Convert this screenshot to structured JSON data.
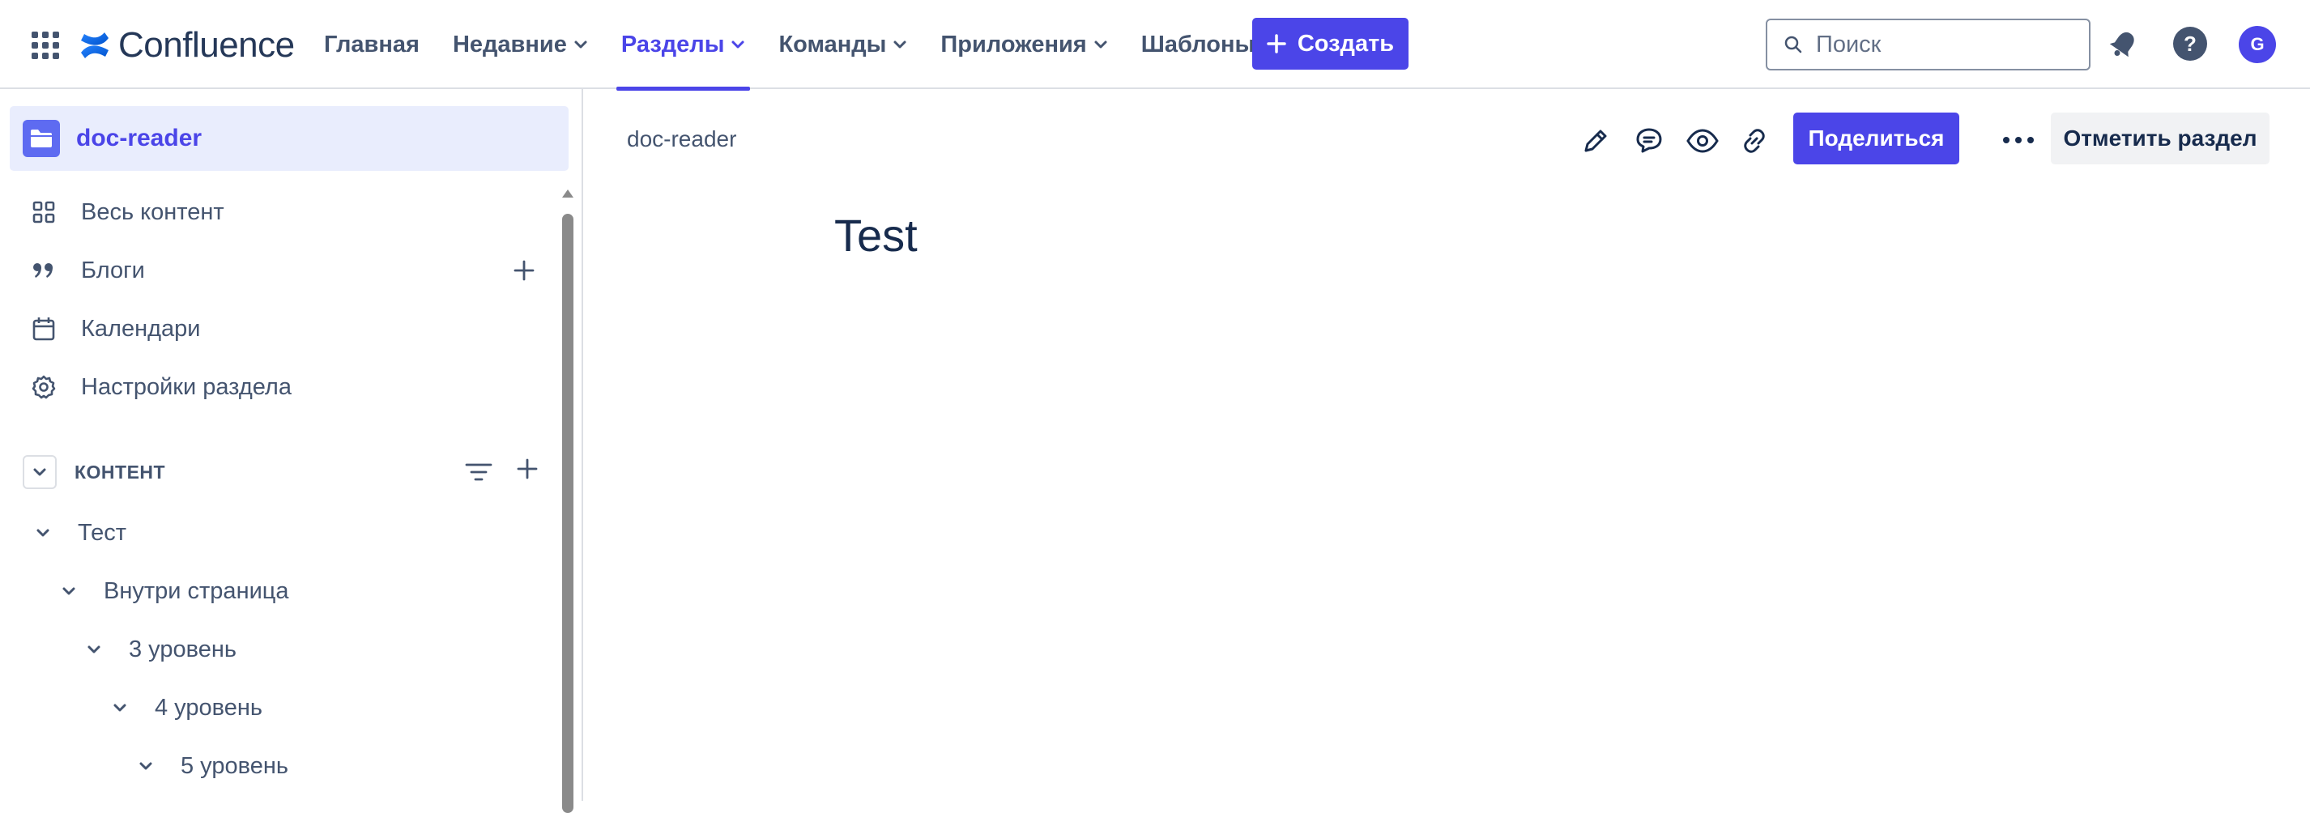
{
  "app": {
    "name": "Confluence"
  },
  "nav": {
    "links": [
      {
        "label": "Главная",
        "has_dropdown": false,
        "active": false
      },
      {
        "label": "Недавние",
        "has_dropdown": true,
        "active": false
      },
      {
        "label": "Разделы",
        "has_dropdown": true,
        "active": true
      },
      {
        "label": "Команды",
        "has_dropdown": true,
        "active": false
      },
      {
        "label": "Приложения",
        "has_dropdown": true,
        "active": false
      },
      {
        "label": "Шаблоны",
        "has_dropdown": false,
        "active": false
      }
    ],
    "create_label": "Создать",
    "search_placeholder": "Поиск",
    "avatar_initial": "G"
  },
  "sidebar": {
    "space_name": "doc-reader",
    "items": [
      {
        "label": "Весь контент",
        "icon": "grid-icon"
      },
      {
        "label": "Блоги",
        "icon": "quote-icon"
      },
      {
        "label": "Календари",
        "icon": "calendar-icon"
      },
      {
        "label": "Настройки раздела",
        "icon": "gear-icon"
      }
    ],
    "content_title": "КОНТЕНТ",
    "tree": [
      {
        "label": "Тест",
        "level": 0
      },
      {
        "label": "Внутри страница",
        "level": 1
      },
      {
        "label": "3 уровень",
        "level": 2
      },
      {
        "label": "4 уровень",
        "level": 3
      },
      {
        "label": "5 уровень",
        "level": 4
      }
    ]
  },
  "main": {
    "breadcrumb": "doc-reader",
    "share_label": "Поделиться",
    "star_label": "Отметить раздел",
    "page_title": "Test"
  },
  "colors": {
    "accent": "#4b45e8",
    "text": "#172b4d",
    "subtle_text": "#44546f",
    "selected_bg": "#e9edfd",
    "border": "#dcdfe4"
  }
}
